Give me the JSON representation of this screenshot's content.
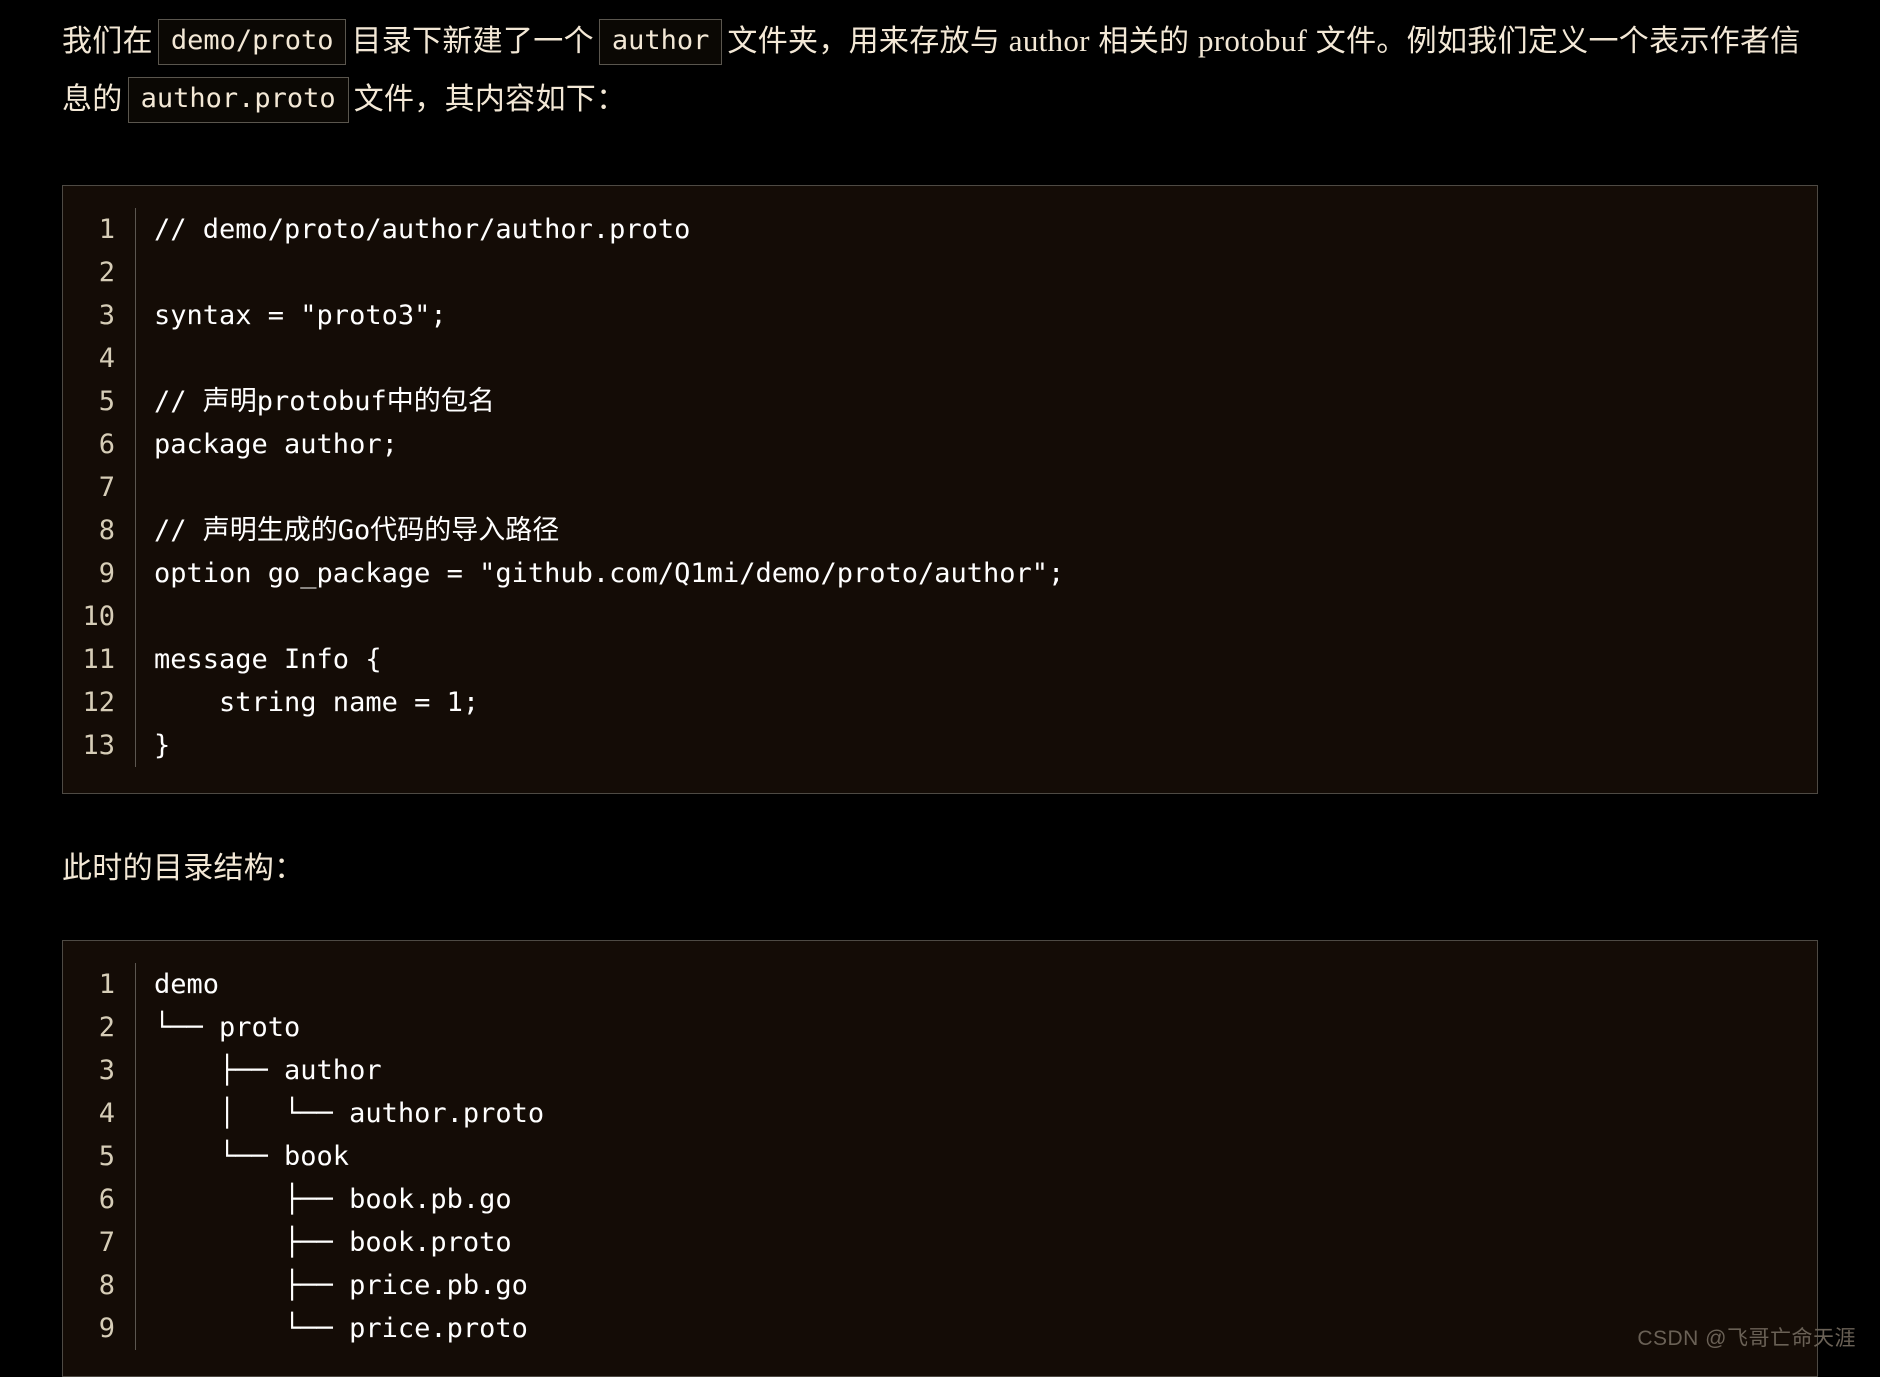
{
  "theme": {
    "page_bg": "#000000",
    "code_bg": "#140C06",
    "code_border": "#4E4A44",
    "prose_text": "#F3E8D6",
    "code_text": "#FFFFFF",
    "line_number_text": "#D6CDB7",
    "watermark_text": "#6A6156"
  },
  "paragraphs": {
    "intro_1": "我们在",
    "intro_code_1": "demo/proto",
    "intro_2": "目录下新建了一个",
    "intro_code_2": "author",
    "intro_3": "文件夹，用来存放与",
    "intro_inline_word_1": "author",
    "intro_4": "相关的",
    "intro_inline_word_2": "protobuf",
    "intro_5": "文件。例如我们定义一个表示作者信息的",
    "intro_code_3": "author.proto",
    "intro_6": "文件，其内容如下：",
    "dir_structure_label": "此时的目录结构："
  },
  "code_block_proto": {
    "language": "protobuf",
    "line_numbers": [
      "1",
      "2",
      "3",
      "4",
      "5",
      "6",
      "7",
      "8",
      "9",
      "10",
      "11",
      "12",
      "13"
    ],
    "lines": [
      "// demo/proto/author/author.proto",
      "",
      "syntax = \"proto3\";",
      "",
      "// 声明protobuf中的包名",
      "package author;",
      "",
      "// 声明生成的Go代码的导入路径",
      "option go_package = \"github.com/Q1mi/demo/proto/author\";",
      "",
      "message Info {",
      "    string name = 1;",
      "}"
    ]
  },
  "code_block_tree": {
    "language": "text",
    "line_numbers": [
      "1",
      "2",
      "3",
      "4",
      "5",
      "6",
      "7",
      "8",
      "9"
    ],
    "lines": [
      "demo",
      "└── proto",
      "    ├── author",
      "    │   └── author.proto",
      "    └── book",
      "        ├── book.pb.go",
      "        ├── book.proto",
      "        ├── price.pb.go",
      "        └── price.proto"
    ]
  },
  "watermark": {
    "text": "CSDN @飞哥亡命天涯"
  }
}
